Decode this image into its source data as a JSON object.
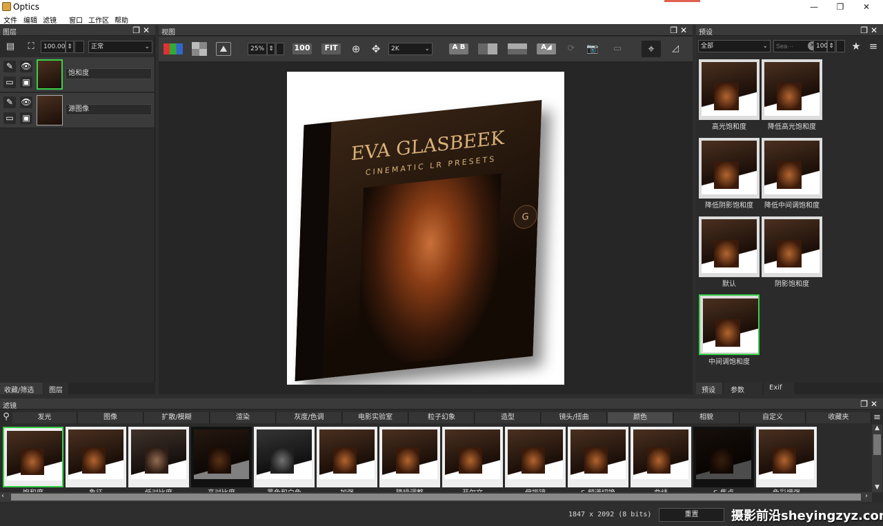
{
  "app": {
    "title": "Optics",
    "accent": "#39d14a"
  },
  "menu": [
    "文件",
    "编辑",
    "滤镜",
    "窗口",
    "工作区",
    "帮助"
  ],
  "layers": {
    "title": "图层",
    "opacity": "100.00",
    "blend": "正常",
    "items": [
      {
        "name": "饱和度"
      },
      {
        "name": "源图像"
      }
    ],
    "tabs": [
      "收藏/筛选",
      "图层"
    ]
  },
  "view": {
    "title": "视图",
    "zoom": "25%",
    "btn_100": "100",
    "btn_fit": "FIT",
    "res": "2K",
    "ab": "A B",
    "image": {
      "brand": "EVA GLASBEEK",
      "tagline": "CINEMATIC LR PRESETS"
    }
  },
  "presets": {
    "title": "预设",
    "filter": "全部",
    "search_placeholder": "Sea···",
    "size": "100",
    "items": [
      "高光饱和度",
      "降低高光饱和度",
      "降低阴影饱和度",
      "降低中间调饱和度",
      "默认",
      "阴影饱和度",
      "中间调饱和度"
    ],
    "tabs": [
      "预设",
      "参数",
      "Exif"
    ]
  },
  "filters": {
    "title": "滤镜",
    "categories": [
      "发光",
      "图像",
      "扩散/模糊",
      "渲染",
      "灰度/色调",
      "电影实验室",
      "粒子幻象",
      "造型",
      "镜头/扭曲",
      "颜色",
      "相貌",
      "自定义",
      "收藏夹"
    ],
    "items": [
      "饱和度",
      "象征",
      "低对比度",
      "高对比度",
      "黑色和白色",
      "加强",
      "降噪调整",
      "开尔文",
      "偏振镜",
      "S-频道切换",
      "曲线",
      "S-焦点",
      "色彩增强"
    ]
  },
  "status": {
    "info": "1847 x 2092 (8 bits)",
    "reset": "重置",
    "watermark": "摄影前沿sheyingzyz.com"
  }
}
